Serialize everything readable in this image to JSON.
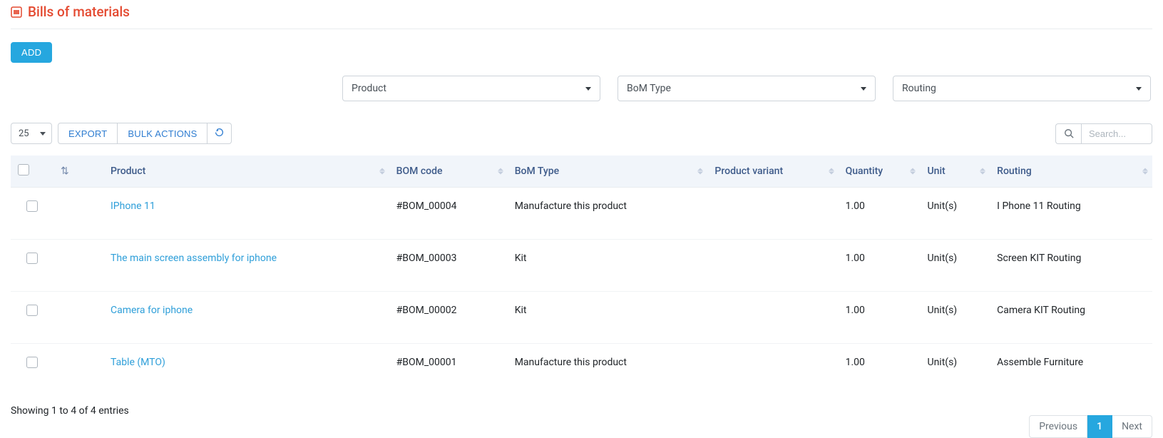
{
  "header": {
    "title": "Bills of materials"
  },
  "actions": {
    "add_label": "ADD"
  },
  "filters": {
    "product": {
      "label": "Product"
    },
    "bom_type": {
      "label": "BoM Type"
    },
    "routing": {
      "label": "Routing"
    }
  },
  "toolbar": {
    "page_size": "25",
    "export_label": "EXPORT",
    "bulk_label": "BULK ACTIONS",
    "search_placeholder": "Search..."
  },
  "columns": {
    "product": "Product",
    "bom_code": "BOM code",
    "bom_type": "BoM Type",
    "variant": "Product variant",
    "qty": "Quantity",
    "unit": "Unit",
    "routing": "Routing"
  },
  "rows": [
    {
      "product": "IPhone 11",
      "bom_code": "#BOM_00004",
      "bom_type": "Manufacture this product",
      "variant": "",
      "qty": "1.00",
      "unit": "Unit(s)",
      "routing": "I Phone 11 Routing"
    },
    {
      "product": "The main screen assembly for iphone",
      "bom_code": "#BOM_00003",
      "bom_type": "Kit",
      "variant": "",
      "qty": "1.00",
      "unit": "Unit(s)",
      "routing": "Screen KIT Routing"
    },
    {
      "product": "Camera for iphone",
      "bom_code": "#BOM_00002",
      "bom_type": "Kit",
      "variant": "",
      "qty": "1.00",
      "unit": "Unit(s)",
      "routing": "Camera KIT Routing"
    },
    {
      "product": "Table (MTO)",
      "bom_code": "#BOM_00001",
      "bom_type": "Manufacture this product",
      "variant": "",
      "qty": "1.00",
      "unit": "Unit(s)",
      "routing": "Assemble Furniture"
    }
  ],
  "footer": {
    "info": "Showing 1 to 4 of 4 entries"
  },
  "pager": {
    "prev": "Previous",
    "page1": "1",
    "next": "Next"
  }
}
